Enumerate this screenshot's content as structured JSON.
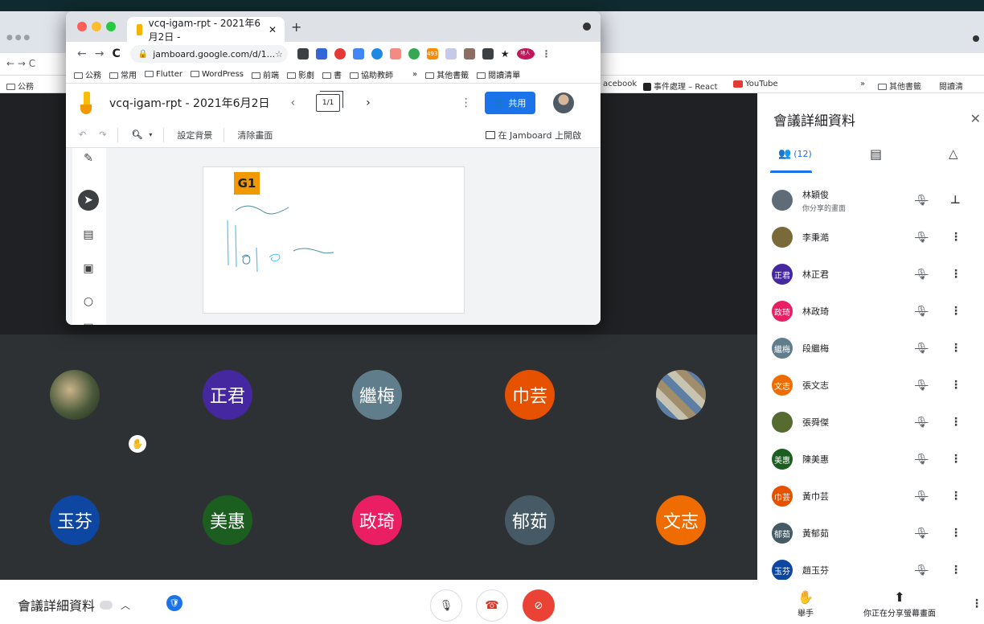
{
  "bg_chrome": {
    "bookmarks_left": [
      "公務"
    ],
    "bookmarks_right": [
      "acebook",
      "事件處理 – React",
      "YouTube",
      "»",
      "其他書籤",
      "閱讀清"
    ],
    "ext_badge": "493"
  },
  "jam_window": {
    "tab_title": "vcq-igam-rpt - 2021年6月2日 -",
    "new_tab": "+",
    "url": "jamboard.google.com/d/1...",
    "bookmarks": [
      "公務",
      "常用",
      "Flutter",
      "WordPress",
      "前端",
      "影劇",
      "書",
      "協助教師"
    ],
    "bookmarks_overflow": "»",
    "other_bookmarks": "其他書籤",
    "reading_list": "閱讀清單",
    "ext_badge": "493",
    "profile_badge": "地人"
  },
  "jamboard": {
    "title": "vcq-igam-rpt - 2021年6月2日",
    "frame_counter": "1/1",
    "share_label": "共用",
    "toolbar": {
      "set_background": "設定背景",
      "clear_frame": "清除畫面",
      "open_in_jamboard": "在 Jamboard 上開啟"
    },
    "sticky_note": "G1"
  },
  "stage": {
    "tiles_row1": [
      {
        "label": "",
        "kind": "photo-a"
      },
      {
        "label": "正君",
        "color": "#4527a0"
      },
      {
        "label": "繼梅",
        "color": "#607d8b"
      },
      {
        "label": "巾芸",
        "color": "#e65100"
      },
      {
        "label": "",
        "kind": "photo-b"
      }
    ],
    "tiles_row2": [
      {
        "label": "玉芬",
        "color": "#0d47a1"
      },
      {
        "label": "美惠",
        "color": "#1b5e20"
      },
      {
        "label": "政琦",
        "color": "#e91e63"
      },
      {
        "label": "郁茹",
        "color": "#455a64"
      },
      {
        "label": "文志",
        "color": "#ef6c00"
      }
    ]
  },
  "panel": {
    "title": "會議詳細資料",
    "people_count": "(12)",
    "participants": [
      {
        "name": "林穎俊",
        "sub": "你分享的畫面",
        "avatar": "",
        "color": "#5f6b77"
      },
      {
        "name": "李秉澔",
        "sub": "",
        "avatar": "",
        "color": "#7a6a3a"
      },
      {
        "name": "林正君",
        "sub": "",
        "avatar": "正君",
        "color": "#4527a0"
      },
      {
        "name": "林政琦",
        "sub": "",
        "avatar": "政琦",
        "color": "#e91e63"
      },
      {
        "name": "段繼梅",
        "sub": "",
        "avatar": "繼梅",
        "color": "#607d8b"
      },
      {
        "name": "張文志",
        "sub": "",
        "avatar": "文志",
        "color": "#ef6c00"
      },
      {
        "name": "張舜傑",
        "sub": "",
        "avatar": "",
        "color": "#556b2f"
      },
      {
        "name": "陳美惠",
        "sub": "",
        "avatar": "美惠",
        "color": "#1b5e20"
      },
      {
        "name": "黃巾芸",
        "sub": "",
        "avatar": "巾芸",
        "color": "#e65100"
      },
      {
        "name": "黃郁茹",
        "sub": "",
        "avatar": "郁茹",
        "color": "#455a64"
      },
      {
        "name": "趙玉芬",
        "sub": "",
        "avatar": "玉芬",
        "color": "#0d47a1"
      }
    ]
  },
  "bottom_bar": {
    "meeting_details": "會議詳細資料",
    "raise_hand": "舉手",
    "presenting": "你正在分享螢幕畫面"
  }
}
